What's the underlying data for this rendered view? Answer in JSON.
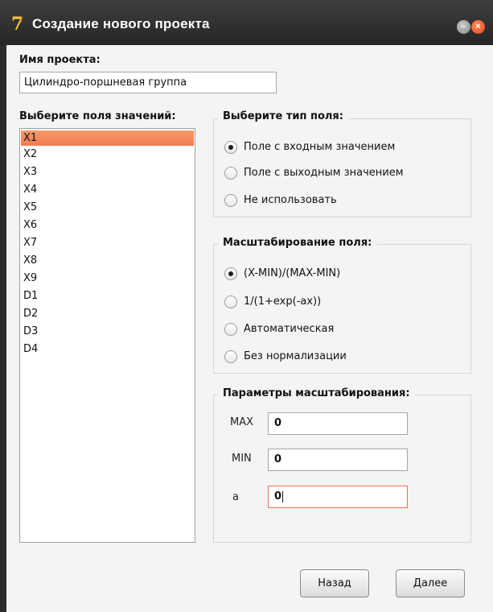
{
  "window": {
    "title": "Создание нового проекта",
    "icon": "app-logo-icon",
    "controls": [
      "minimize-icon",
      "close-icon"
    ],
    "accent_color": "#ef7c4f"
  },
  "project": {
    "label": "Имя проекта:",
    "value": "Цилиндро-поршневая группа"
  },
  "fields": {
    "label": "Выберите поля значений:",
    "items": [
      "X1",
      "X2",
      "X3",
      "X4",
      "X5",
      "X6",
      "X7",
      "X8",
      "X9",
      "D1",
      "D2",
      "D3",
      "D4"
    ],
    "selected": "X1"
  },
  "field_type": {
    "title": "Выберите тип поля:",
    "options": [
      {
        "label": "Поле с входным значением",
        "checked": true
      },
      {
        "label": "Поле с выходным значением",
        "checked": false
      },
      {
        "label": "Не использовать",
        "checked": false
      }
    ]
  },
  "scaling": {
    "title": "Масштабирование поля:",
    "options": [
      {
        "label": "(X-MIN)/(MAX-MIN)",
        "checked": true
      },
      {
        "label": "1/(1+exp(-ax))",
        "checked": false
      },
      {
        "label": "Автоматическая",
        "checked": false
      },
      {
        "label": "Без нормализации",
        "checked": false
      }
    ]
  },
  "params": {
    "title": "Параметры масштабирования:",
    "max_label": "MAX",
    "max_value": "0",
    "min_label": "MIN",
    "min_value": "0",
    "a_label": "a",
    "a_value": "0"
  },
  "buttons": {
    "back": "Назад",
    "next": "Далее"
  }
}
